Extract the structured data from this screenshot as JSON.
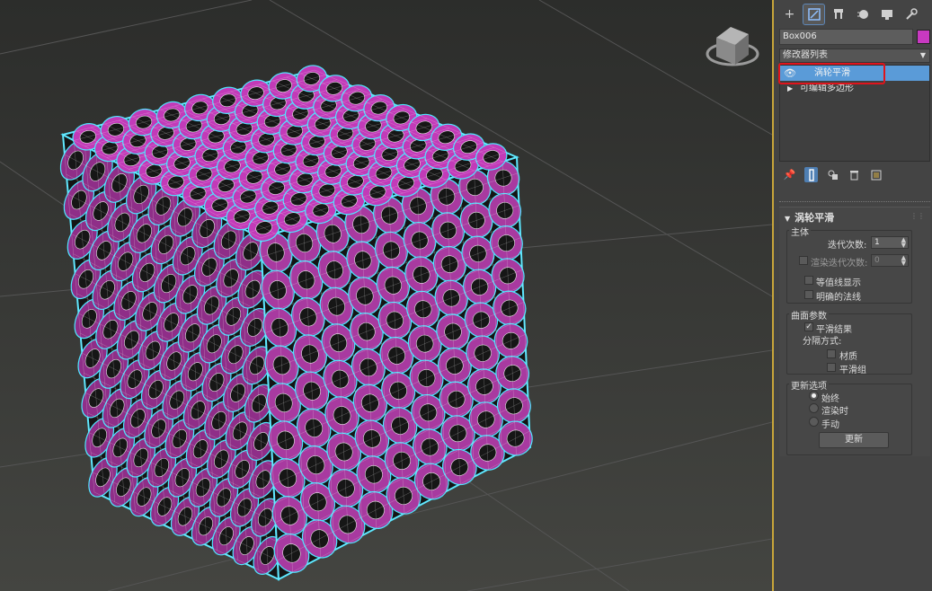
{
  "object": {
    "name": "Box006",
    "color": "#c839c1"
  },
  "modifier_list": {
    "label": "修改器列表"
  },
  "stack": [
    {
      "label": "涡轮平滑",
      "selected": true
    },
    {
      "label": "可编辑多边形",
      "selected": false
    }
  ],
  "tabs": [
    "create-tab",
    "modify-tab",
    "hierarchy-tab",
    "motion-tab",
    "display-tab",
    "utilities-tab"
  ],
  "rollout": {
    "title": "涡轮平滑",
    "main": {
      "label": "主体",
      "iterations_label": "迭代次数:",
      "iterations_value": "1",
      "render_iters_label": "渲染迭代次数:",
      "render_iters_value": "0",
      "isoline_label": "等值线显示",
      "explicit_normals_label": "明确的法线"
    },
    "surface": {
      "label": "曲面参数",
      "smooth_result_label": "平滑结果",
      "smooth_result_checked": true,
      "separate_by_label": "分隔方式:",
      "materials_label": "材质",
      "smoothing_groups_label": "平滑组"
    },
    "update": {
      "label": "更新选项",
      "always_label": "始终",
      "when_rendering_label": "渲染时",
      "manually_label": "手动",
      "selected": "always",
      "update_button": "更新"
    }
  },
  "colors": {
    "mesh": "#c23ab8",
    "selection_outline": "#4fe6ff",
    "highlight": "#e0141c",
    "selected_row": "#5a9bd8"
  }
}
